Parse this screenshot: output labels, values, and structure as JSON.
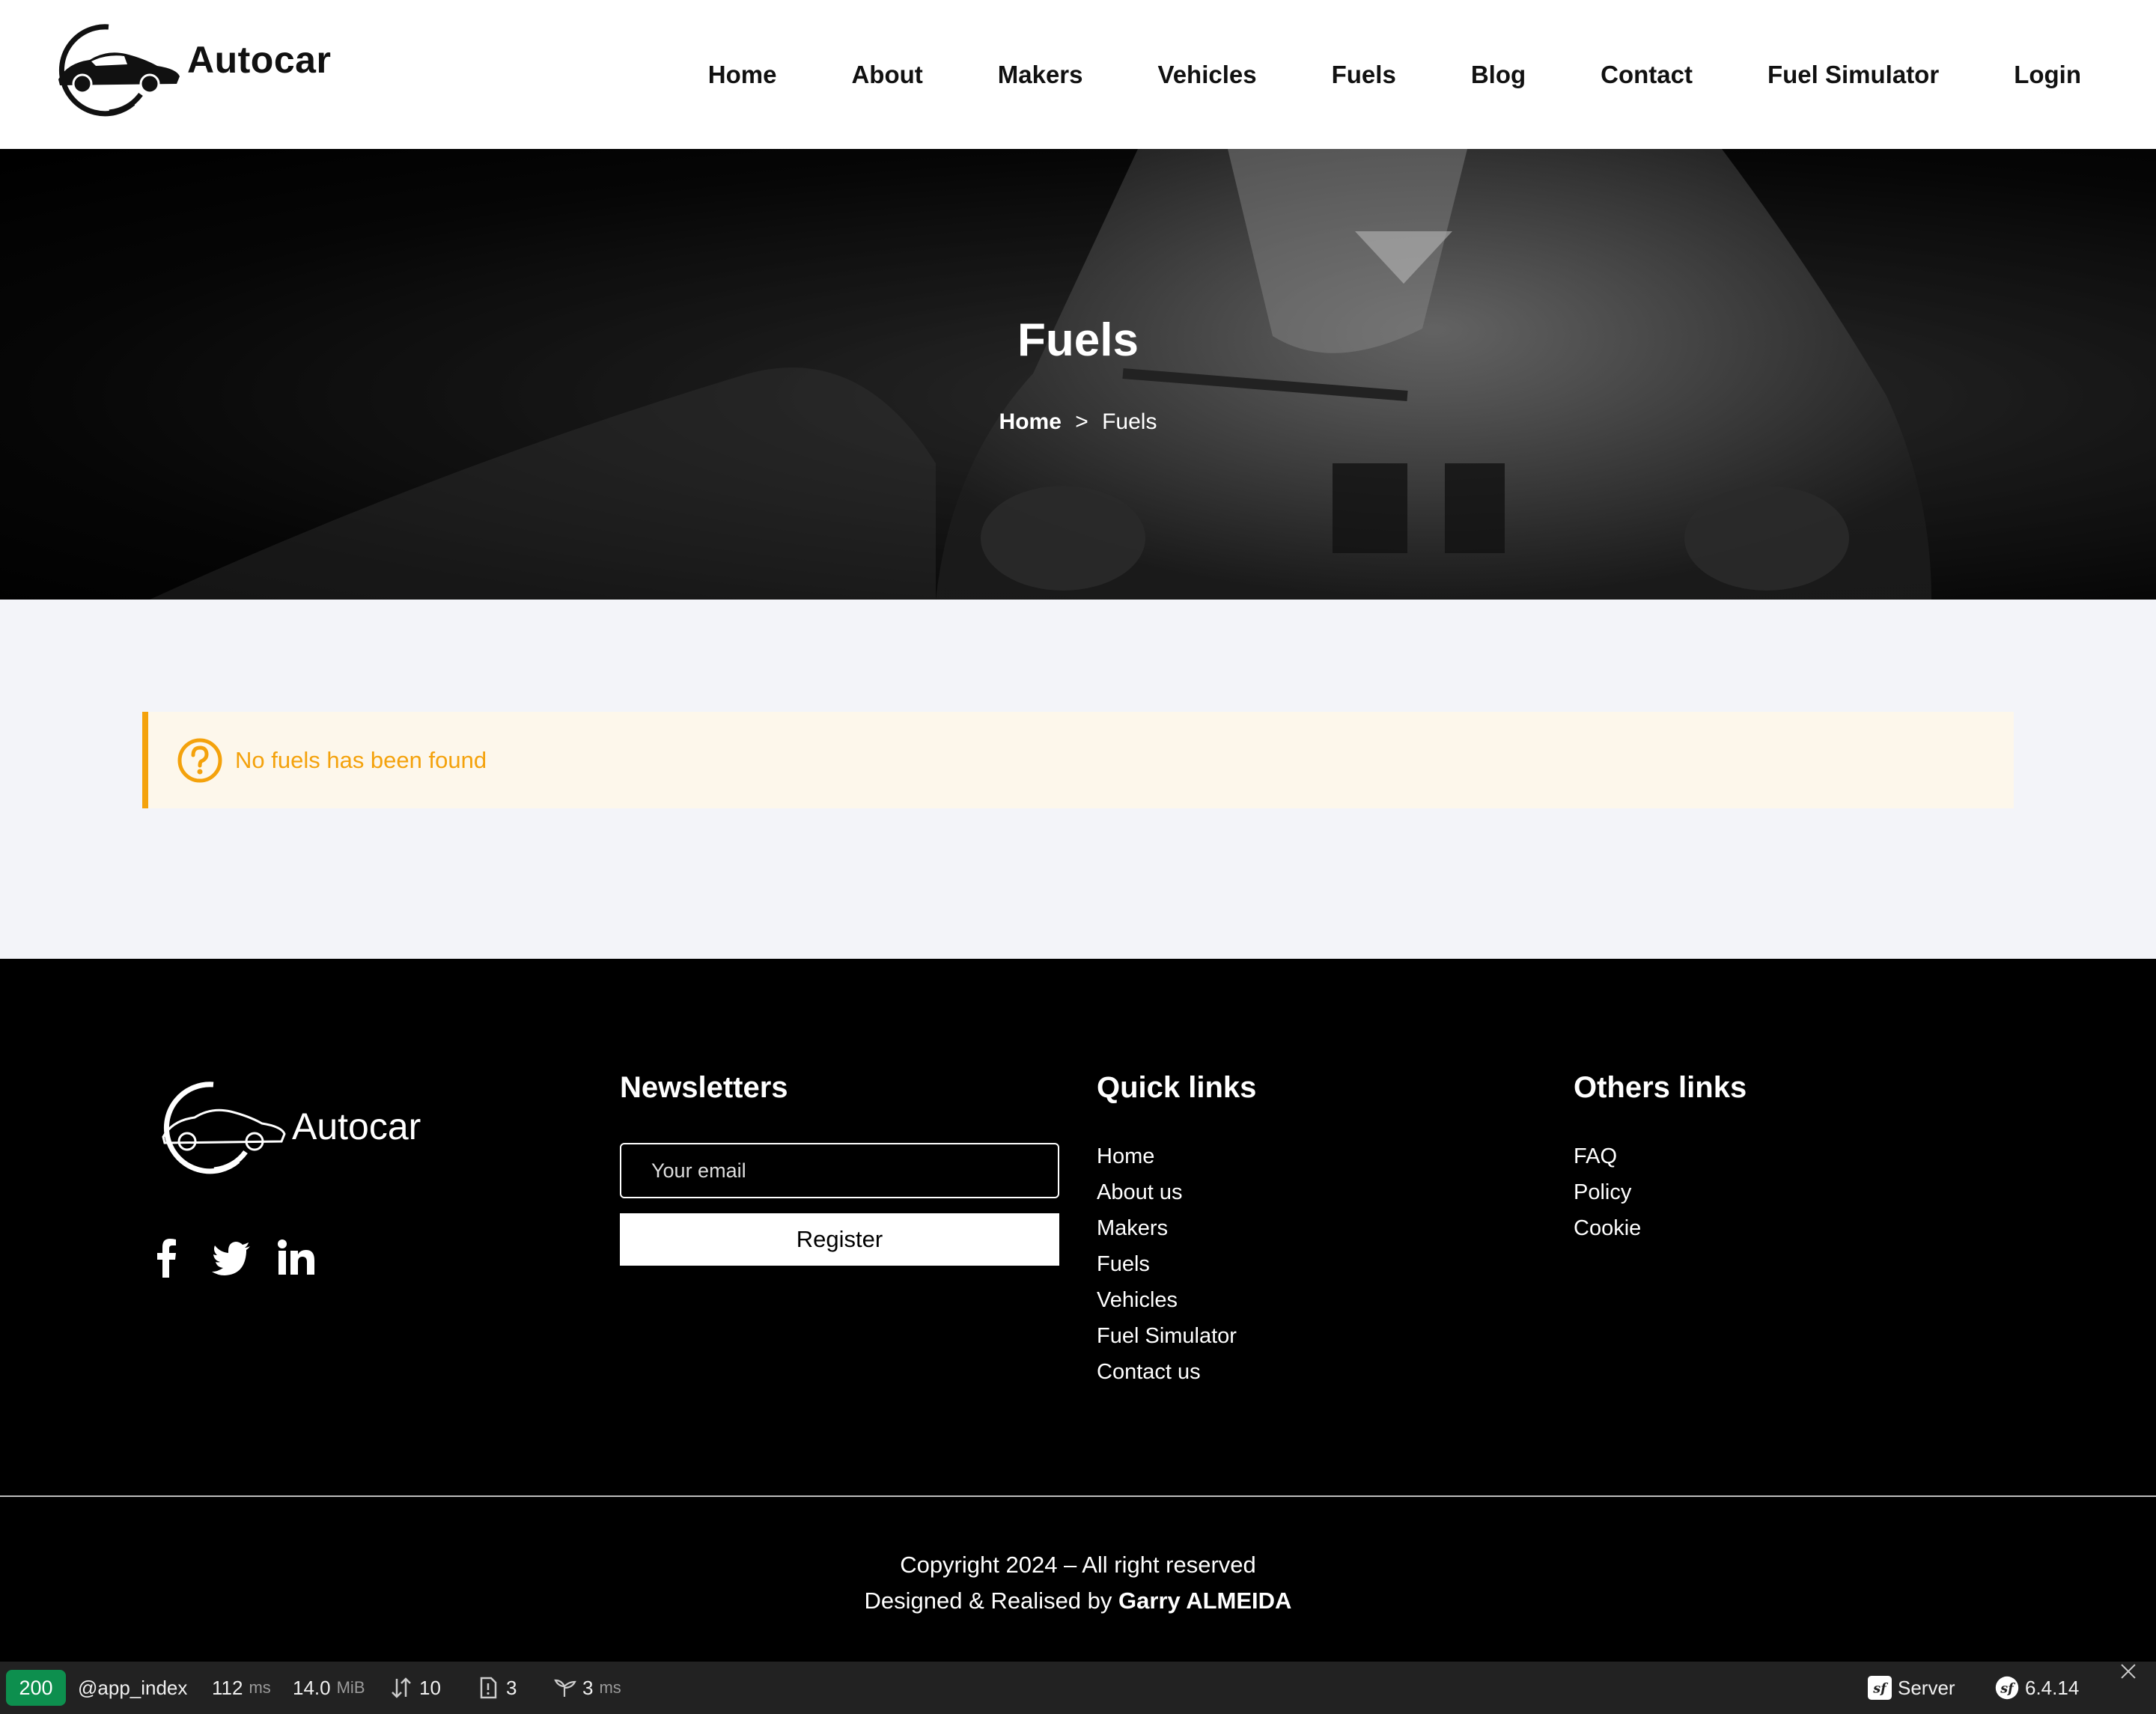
{
  "header": {
    "brand_name": "Autocar",
    "nav": [
      "Home",
      "About",
      "Makers",
      "Vehicles",
      "Fuels",
      "Blog",
      "Contact",
      "Fuel Simulator",
      "Login"
    ]
  },
  "hero": {
    "title": "Fuels",
    "breadcrumb": {
      "home": "Home",
      "separator": ">",
      "current": "Fuels"
    }
  },
  "main": {
    "alert": {
      "icon": "question-circle-icon",
      "text": "No fuels has been found",
      "color": "#f4a20c",
      "background": "#fdf7eb"
    }
  },
  "footer": {
    "brand_name": "Autocar",
    "socials": [
      "facebook-icon",
      "twitter-icon",
      "linkedin-icon"
    ],
    "newsletter": {
      "title": "Newsletters",
      "placeholder": "Your email",
      "button": "Register"
    },
    "quick_links": {
      "title": "Quick links",
      "items": [
        "Home",
        "About us",
        "Makers",
        "Fuels",
        "Vehicles",
        "Fuel Simulator",
        "Contact us"
      ]
    },
    "other_links": {
      "title": "Others links",
      "items": [
        "FAQ",
        "Policy",
        "Cookie"
      ]
    },
    "copyright": "Copyright 2024 – All right reserved",
    "designed_prefix": "Designed & Realised by",
    "designer": "Garry ALMEIDA"
  },
  "debug_toolbar": {
    "status": "200",
    "route": "@app_index",
    "time_value": "112",
    "time_unit": "ms",
    "memory_value": "14.0",
    "memory_unit": "MiB",
    "requests": "10",
    "logs": "3",
    "twig_value": "3",
    "twig_unit": "ms",
    "server": "Server",
    "version": "6.4.14",
    "status_color": "#0d8f4e"
  }
}
